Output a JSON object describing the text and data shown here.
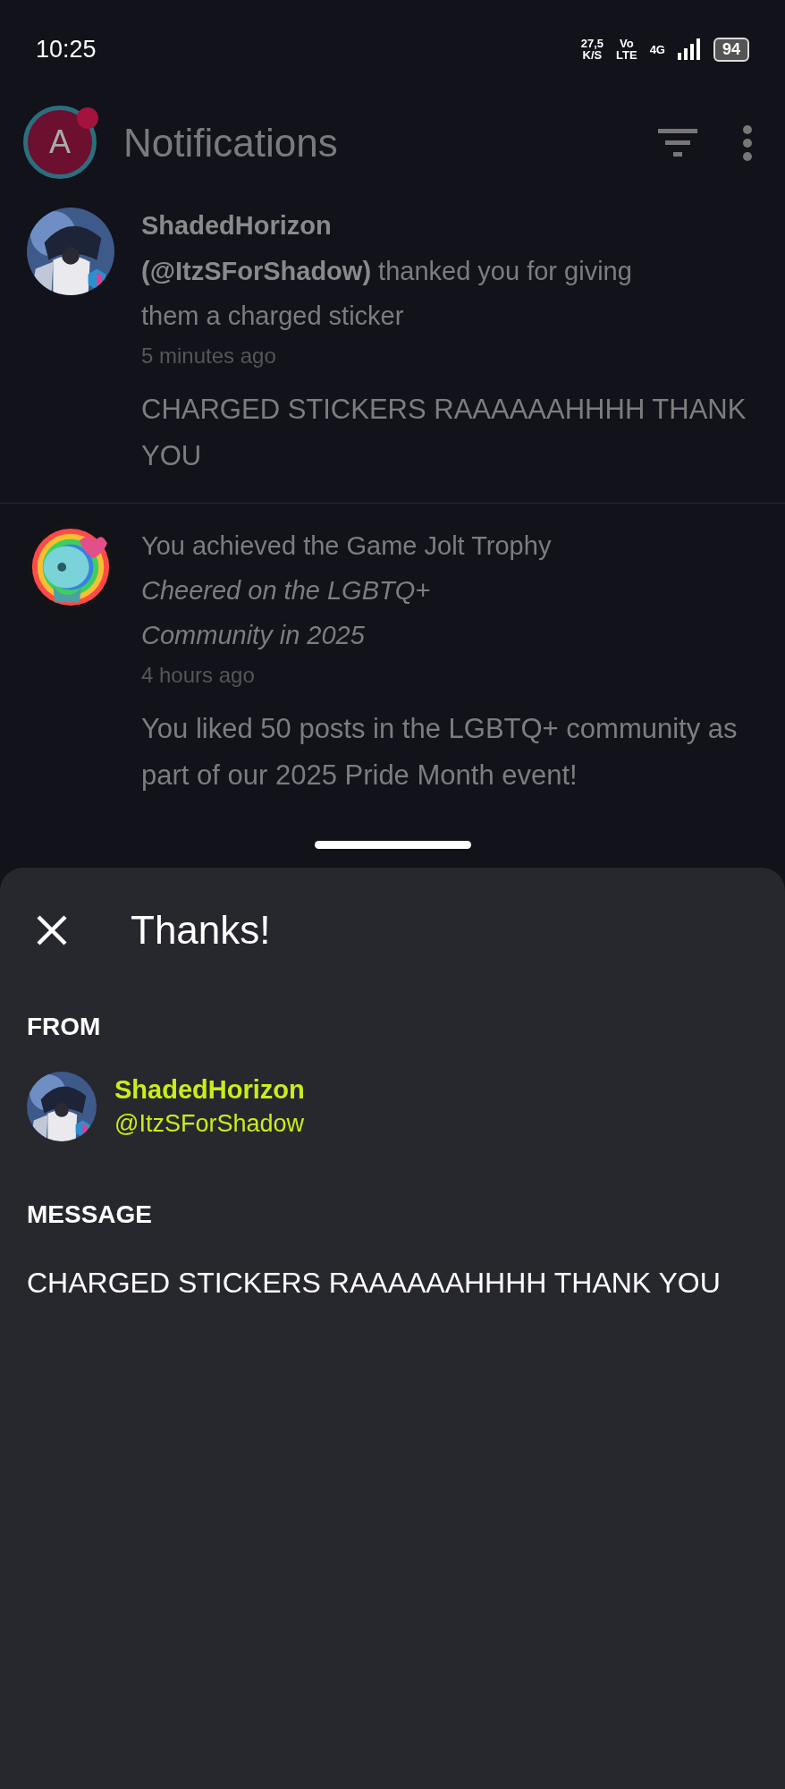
{
  "status_bar": {
    "time": "10:25",
    "speed": "27,5",
    "speed_unit": "K/S",
    "volte_top": "Vo",
    "volte_bottom": "LTE",
    "network": "4G",
    "battery": "94"
  },
  "header": {
    "avatar_letter": "A",
    "unread_dot": true,
    "title": "Notifications"
  },
  "notifications": [
    {
      "kind": "thanks",
      "name": "ShadedHorizon",
      "handle": "(@ItzSForShadow)",
      "text": "thanked you for giving them a charged sticker",
      "time": "5 minutes ago",
      "message": "CHARGED STICKERS RAAAAAAHHHH THANK YOU"
    },
    {
      "kind": "trophy",
      "text": "You achieved the Game Jolt Trophy",
      "trophy": "Cheered on the LGBTQ+ Community in 2025",
      "time": "4 hours ago",
      "message": "You liked 50 posts in the LGBTQ+ community as part of our 2025 Pride Month event!"
    }
  ],
  "sheet": {
    "title": "Thanks!",
    "from_label": "FROM",
    "name": "ShadedHorizon",
    "handle": "@ItzSForShadow",
    "message_label": "MESSAGE",
    "message": "CHARGED STICKERS RAAAAAAHHHH THANK YOU"
  }
}
